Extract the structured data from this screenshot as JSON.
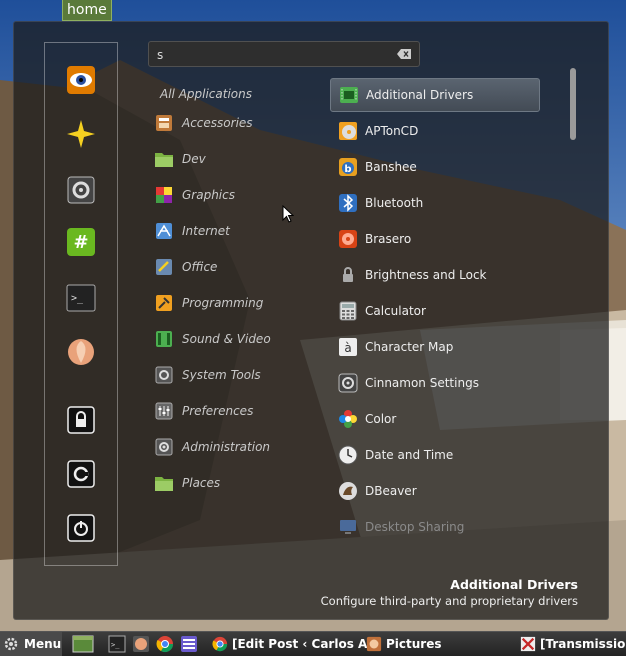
{
  "desktop": {
    "icon_label": "home"
  },
  "search": {
    "value": "s",
    "placeholder": ""
  },
  "categories": [
    {
      "label": "All Applications",
      "icon": ""
    },
    {
      "label": "Accessories",
      "icon": "accessories-icon"
    },
    {
      "label": "Dev",
      "icon": "folder-icon"
    },
    {
      "label": "Graphics",
      "icon": "graphics-icon"
    },
    {
      "label": "Internet",
      "icon": "internet-icon"
    },
    {
      "label": "Office",
      "icon": "office-icon"
    },
    {
      "label": "Programming",
      "icon": "programming-icon"
    },
    {
      "label": "Sound & Video",
      "icon": "sound-video-icon"
    },
    {
      "label": "System Tools",
      "icon": "system-tools-icon"
    },
    {
      "label": "Preferences",
      "icon": "preferences-icon"
    },
    {
      "label": "Administration",
      "icon": "administration-icon"
    },
    {
      "label": "Places",
      "icon": "folder-icon"
    }
  ],
  "apps": [
    {
      "label": "Additional Drivers",
      "icon": "chip-icon"
    },
    {
      "label": "APTonCD",
      "icon": "cd-icon"
    },
    {
      "label": "Banshee",
      "icon": "banshee-icon"
    },
    {
      "label": "Bluetooth",
      "icon": "bluetooth-icon"
    },
    {
      "label": "Brasero",
      "icon": "brasero-icon"
    },
    {
      "label": "Brightness and Lock",
      "icon": "lock-icon"
    },
    {
      "label": "Calculator",
      "icon": "calculator-icon"
    },
    {
      "label": "Character Map",
      "icon": "character-map-icon"
    },
    {
      "label": "Cinnamon Settings",
      "icon": "settings-icon"
    },
    {
      "label": "Color",
      "icon": "color-icon"
    },
    {
      "label": "Date and Time",
      "icon": "clock-icon"
    },
    {
      "label": "DBeaver",
      "icon": "dbeaver-icon"
    },
    {
      "label": "Desktop Sharing",
      "icon": "desktop-sharing-icon"
    }
  ],
  "description": {
    "title": "Additional Drivers",
    "text": "Configure third-party and proprietary drivers"
  },
  "taskbar": {
    "menu_label": "Menu",
    "tasks": [
      {
        "label": "[Edit Post ‹ Carlos A..."
      },
      {
        "label": "Pictures"
      },
      {
        "label": "[Transmission]"
      }
    ]
  },
  "colors": {
    "accent": "#5a6470",
    "panel": "#1c1c1c"
  }
}
